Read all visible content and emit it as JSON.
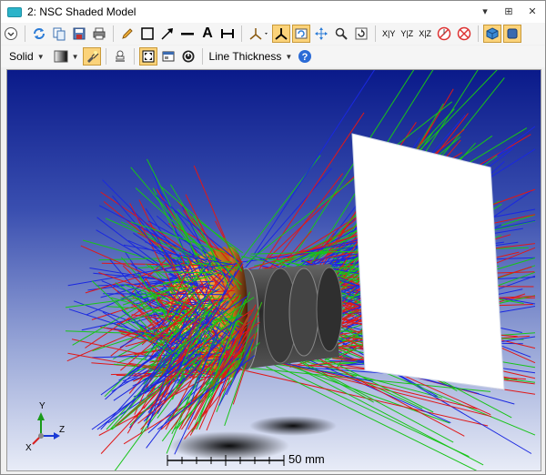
{
  "window": {
    "title": "2: NSC Shaded Model"
  },
  "title_controls": {
    "dropdown": "▾",
    "pin": "⊞",
    "close": "✕"
  },
  "toolbar1": {
    "view_labels": {
      "xy": "X|Y",
      "yz": "Y|Z",
      "xz": "X|Z"
    },
    "text_tool": "A"
  },
  "toolbar2": {
    "render_mode": "Solid",
    "line_thickness": "Line Thickness"
  },
  "viewport": {
    "scale_label": "50 mm",
    "axis_labels": {
      "x": "X",
      "y": "Y",
      "z": "Z"
    }
  },
  "colors": {
    "accent": "#fbd37a",
    "background_top": "#0a1a8a",
    "background_bottom": "#e8ecf7"
  }
}
